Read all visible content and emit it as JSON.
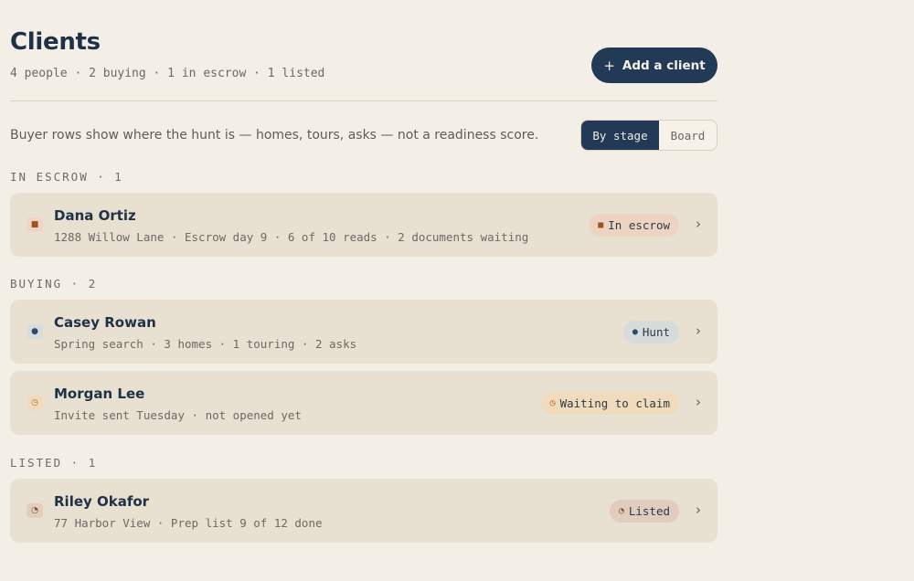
{
  "header": {
    "title": "Clients",
    "summary": "4 people · 2 buying · 1 in escrow · 1 listed",
    "add_button": {
      "icon": "plus-icon",
      "icon_glyph": "+",
      "label": "Add a client"
    }
  },
  "toolbar": {
    "helper_text": "Buyer rows show where the hunt is — homes, tours, asks — not a readiness score.",
    "view_toggle": {
      "options": [
        "By stage",
        "Board"
      ],
      "selected": "By stage"
    }
  },
  "sections": [
    {
      "label": "IN ESCROW · 1",
      "clients": [
        {
          "name": "Dana Ortiz",
          "detail": "1288 Willow Lane · Escrow day 9 · 6 of 10 reads · 2 documents waiting",
          "icon": "square-icon",
          "icon_glyph": "■",
          "badge": {
            "label": "In escrow",
            "glyph": "■",
            "color": "#a2501f"
          }
        }
      ]
    },
    {
      "label": "BUYING · 2",
      "clients": [
        {
          "name": "Casey Rowan",
          "detail": "Spring search · 3 homes · 1 touring · 2 asks",
          "icon": "dot-icon",
          "icon_glyph": "●",
          "badge": {
            "label": "Hunt",
            "glyph": "●",
            "color": "#2b4a6e"
          }
        },
        {
          "name": "Morgan Lee",
          "detail": "Invite sent Tuesday · not opened yet",
          "icon": "clock-icon",
          "icon_glyph": "◷",
          "badge": {
            "label": "Waiting to claim",
            "glyph": "◷",
            "color": "#b16c21"
          }
        }
      ]
    },
    {
      "label": "LISTED · 1",
      "clients": [
        {
          "name": "Riley Okafor",
          "detail": "77 Harbor View · Prep list 9 of 12 done",
          "icon": "progress-icon",
          "icon_glyph": "◔",
          "badge": {
            "label": "Listed",
            "glyph": "◔",
            "color": "#7d4a30"
          }
        }
      ]
    }
  ],
  "chevron_glyph": "›",
  "colors": {
    "background": "#f3efe6",
    "row_background": "#e8e0d1",
    "primary": "#223a56",
    "escrow": "#a2501f",
    "hunt": "#2b4a6e",
    "waiting": "#b16c21",
    "listed": "#7d4a30"
  }
}
